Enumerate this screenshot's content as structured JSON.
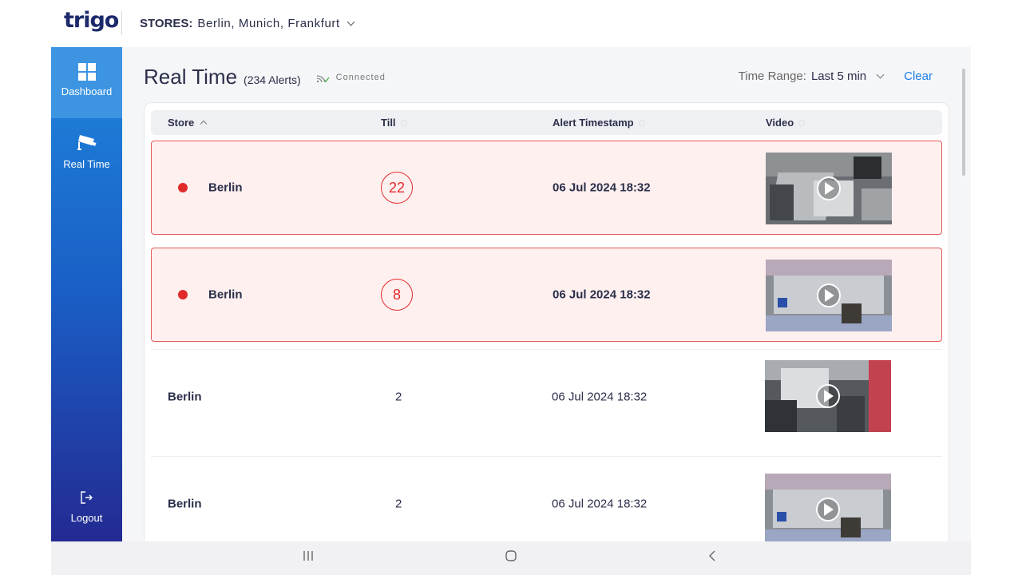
{
  "header": {
    "logo_text": "trigo",
    "stores_label": "STORES:",
    "stores_value": "Berlin, Munich, Frankfurt"
  },
  "sidebar": {
    "items": [
      {
        "label": "Dashboard",
        "icon": "dashboard-grid-icon"
      },
      {
        "label": "Real Time",
        "icon": "security-camera-icon"
      },
      {
        "label": "Logout",
        "icon": "logout-icon"
      }
    ]
  },
  "page": {
    "title": "Real Time",
    "alert_count": "(234 Alerts)",
    "connection_status": "Connected",
    "time_range_label": "Time Range:",
    "time_range_value": "Last 5 min",
    "clear_label": "Clear"
  },
  "table": {
    "columns": [
      "Store",
      "Till",
      "Alert Timestamp",
      "Video"
    ],
    "rows": [
      {
        "store": "Berlin",
        "till": "22",
        "timestamp": "06 Jul 2024 18:32",
        "alert": true
      },
      {
        "store": "Berlin",
        "till": "8",
        "timestamp": "06 Jul 2024 18:32",
        "alert": true
      },
      {
        "store": "Berlin",
        "till": "2",
        "timestamp": "06 Jul 2024 18:32",
        "alert": false
      },
      {
        "store": "Berlin",
        "till": "2",
        "timestamp": "06 Jul 2024 18:32",
        "alert": false
      }
    ]
  },
  "colors": {
    "accent": "#1c7ee6",
    "alert_red": "#e12b2b",
    "alert_bg": "#fff0f0",
    "brand_navy": "#1c2a6b"
  }
}
